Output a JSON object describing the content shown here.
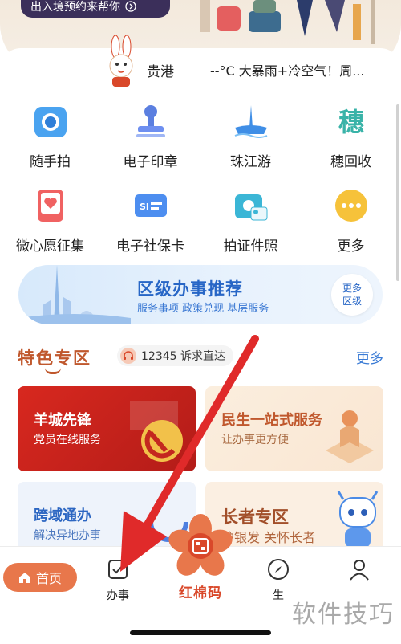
{
  "banner": {
    "pill_text": "出入境预约来帮你",
    "pill_icon": "chevron-circle-icon"
  },
  "weather": {
    "city": "贵港",
    "summary": "--°C  大暴雨+冷空气！周..."
  },
  "services": [
    {
      "label": "随手拍",
      "icon": "camera-icon"
    },
    {
      "label": "电子印章",
      "icon": "stamp-icon"
    },
    {
      "label": "珠江游",
      "icon": "cruise-icon"
    },
    {
      "label": "穗回收",
      "icon": "recycle-icon"
    },
    {
      "label": "微心愿征集",
      "icon": "heart-card-icon"
    },
    {
      "label": "电子社保卡",
      "icon": "social-security-card-icon"
    },
    {
      "label": "拍证件照",
      "icon": "id-photo-icon"
    },
    {
      "label": "更多",
      "icon": "more-dots-icon"
    }
  ],
  "promo": {
    "title": "区级办事推荐",
    "subtitle": "服务事项  政策兑现  基层服务",
    "more_line1": "更多",
    "more_line2": "区级"
  },
  "section": {
    "title": "特色专区",
    "badge": "12345 诉求直达",
    "more": "更多"
  },
  "cards": {
    "c1": {
      "title": "羊城先锋",
      "subtitle": "党员在线服务"
    },
    "c2": {
      "title": "民生一站式服务",
      "subtitle": "让办事更方便"
    },
    "c3": {
      "title": "跨域通办",
      "subtitle": "解决异地办事"
    },
    "c4": {
      "title": "长者专区",
      "subtitle": "护银发 关怀长者"
    }
  },
  "tabbar": {
    "home": "首页",
    "affairs": "办事",
    "center": "红棉码",
    "life": "生",
    "profile": ""
  },
  "watermark": "软件技巧",
  "colors": {
    "accent": "#e8774b",
    "brand_red": "#d9482a",
    "link_blue": "#3a7bd5"
  }
}
